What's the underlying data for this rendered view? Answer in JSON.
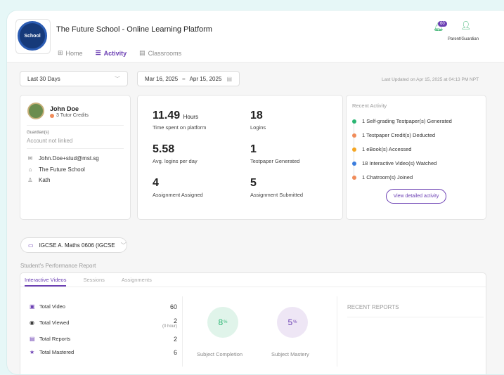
{
  "app": {
    "title": "The Future School - Online Learning Platform",
    "logo_text": "School"
  },
  "nav": [
    {
      "label": "Home",
      "icon": "grid-icon",
      "active": false
    },
    {
      "label": "Activity",
      "icon": "list-icon",
      "active": true
    },
    {
      "label": "Classrooms",
      "icon": "book-icon",
      "active": false
    }
  ],
  "header": {
    "notification_count": "60",
    "user_label": "Parent/Guardian"
  },
  "filters": {
    "range": "Last 30 Days",
    "date_from": "Mar 16, 2025",
    "date_sep": "–",
    "date_to": "Apr 15, 2025",
    "last_updated": "Last Updated on Apr 15, 2025 at 04:13 PM NPT"
  },
  "profile": {
    "name": "John Doe",
    "credits": "3 Tutor Credits",
    "guardian_label": "Guardian(s)",
    "guardian_value": "Account not linked",
    "email": "John.Doe+stud@mst.sg",
    "school": "The Future School",
    "extra": "Kath"
  },
  "stats": {
    "time_value": "11.49",
    "time_unit": "Hours",
    "time_label": "Time spent on platform",
    "logins_value": "18",
    "logins_label": "Logins",
    "avg_value": "5.58",
    "avg_label": "Avg. logins per day",
    "tp_value": "1",
    "tp_label": "Testpaper Generated",
    "asg_value": "4",
    "asg_label": "Assignment Assigned",
    "sub_value": "5",
    "sub_label": "Assignment Submitted"
  },
  "recent_activity": {
    "title": "Recent Activity",
    "items": [
      {
        "text": "1 Self-grading Testpaper(s) Generated",
        "color": "#2bb673"
      },
      {
        "text": "1 Testpaper Credit(s) Deducted",
        "color": "#f08c5a"
      },
      {
        "text": "1 eBook(s) Accessed",
        "color": "#f5a623"
      },
      {
        "text": "18 Interactive Video(s) Watched",
        "color": "#3b7ddd"
      },
      {
        "text": "1 Chatroom(s) Joined",
        "color": "#f08c5a"
      }
    ],
    "button": "View detailed activity"
  },
  "course": {
    "label": "IGCSE A. Maths 0606 (IGCSE"
  },
  "report": {
    "title": "Student's Performance Report",
    "tabs": [
      "Interactive Videos",
      "Sessions",
      "Assignments"
    ],
    "metrics": {
      "total_video_label": "Total Video",
      "total_video_value": "60",
      "total_viewed_label": "Total Viewed",
      "total_viewed_value": "2",
      "total_viewed_sub": "(0 hour)",
      "total_reports_label": "Total Reports",
      "total_reports_value": "2",
      "total_mastered_label": "Total Mastered",
      "total_mastered_value": "6"
    },
    "completion_value": "8",
    "completion_unit": "%",
    "completion_label": "Subject Completion",
    "mastery_value": "5",
    "mastery_unit": "%",
    "mastery_label": "Subject Mastery",
    "recent_reports": "RECENT REPORTS"
  }
}
